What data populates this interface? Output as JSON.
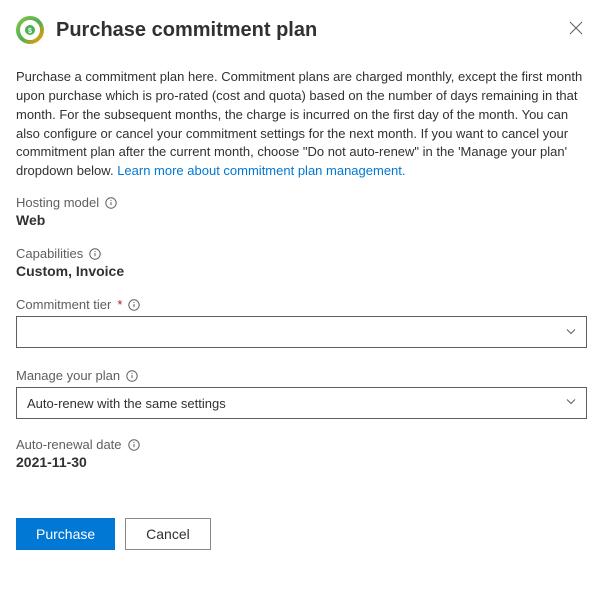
{
  "header": {
    "title": "Purchase commitment plan"
  },
  "description": {
    "text": "Purchase a commitment plan here. Commitment plans are charged monthly, except the first month upon purchase which is pro-rated (cost and quota) based on the number of days remaining in that month. For the subsequent months, the charge is incurred on the first day of the month. You can also configure or cancel your commitment settings for the next month. If you want to cancel your commitment plan after the current month, choose \"Do not auto-renew\" in the 'Manage your plan' dropdown below. ",
    "link_text": "Learn more about commitment plan management."
  },
  "fields": {
    "hosting_model": {
      "label": "Hosting model",
      "value": "Web"
    },
    "capabilities": {
      "label": "Capabilities",
      "value": "Custom, Invoice"
    },
    "commitment_tier": {
      "label": "Commitment tier",
      "value": ""
    },
    "manage_plan": {
      "label": "Manage your plan",
      "value": "Auto-renew with the same settings"
    },
    "auto_renewal_date": {
      "label": "Auto-renewal date",
      "value": "2021-11-30"
    }
  },
  "footer": {
    "purchase_label": "Purchase",
    "cancel_label": "Cancel"
  }
}
